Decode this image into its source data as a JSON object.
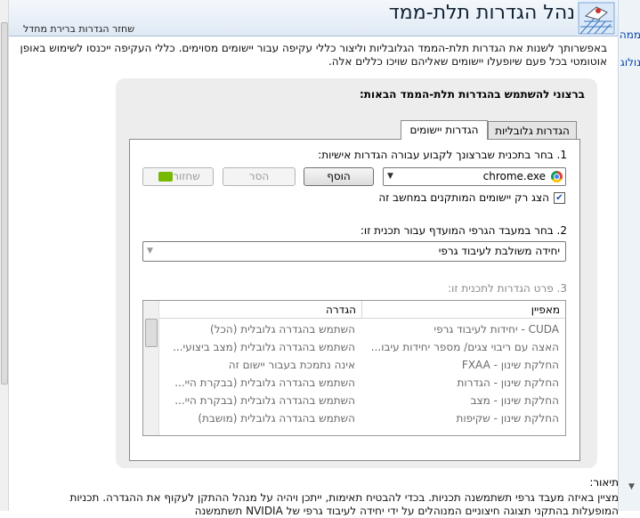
{
  "header": {
    "title": "נהל הגדרות תלת-ממד",
    "restore_link": "שחזר הגדרות ברירת מחדל"
  },
  "intro_text": "באפשרותך לשנות את הגדרות תלת-הממד הגלובליות וליצור כללי עקיפה עבור יישומים מסוימים. כללי העקיפה ייכנסו לשימוש באופן אוטומטי בכל פעם שיופעלו יישומים שאליהם שויכו כללים אלה.",
  "card": {
    "question": "ברצוני להשתמש בהגדרות תלת-הממד הבאות:",
    "tabs": [
      {
        "label": "הגדרות גלובליות",
        "active": false
      },
      {
        "label": "הגדרות יישומים",
        "active": true
      }
    ]
  },
  "step1": {
    "label": "1. בחר בתכנית שברצונך לקבוע עבורה הגדרות אישיות:",
    "program": "chrome.exe",
    "add_button": "הוסף",
    "remove_button": "הסר",
    "restore_button": "שחזור",
    "checkbox_label": "הצג רק יישומים המותקנים במחשב זה",
    "checkbox_checked": true
  },
  "step2": {
    "label": "2. בחר במעבד הגרפי המועדף עבור תכנית זו:",
    "gpu": "יחידה משולבת לעיבוד גרפי"
  },
  "step3": {
    "label": "3. פרט הגדרות לתכנית זו:",
    "columns": {
      "feature": "מאפיין",
      "setting": "הגדרה"
    },
    "rows": [
      {
        "feature": "CUDA - יחידות לעיבוד גרפי",
        "setting": "השתמש בהגדרה גלובלית (הכל)"
      },
      {
        "feature": "האצה עם ריבוי צגים/ מספר יחידות עיבו...",
        "setting": "השתמש בהגדרה גלובלית (מצב ביצועי..."
      },
      {
        "feature": "החלקת שינון - FXAA",
        "setting": "אינה נתמכת בעבור יישום זה"
      },
      {
        "feature": "החלקת שינון - הגדרות",
        "setting": "השתמש בהגדרה גלובלית (בבקרת היי..."
      },
      {
        "feature": "החלקת שינון - מצב",
        "setting": "השתמש בהגדרה גלובלית (בבקרת היי..."
      },
      {
        "feature": "החלקת שינון - שקיפות",
        "setting": "השתמש בהגדרה גלובלית (מושבת)"
      }
    ]
  },
  "description": {
    "label": "תיאור:",
    "text": "מציין באיזה מעבד גרפי תשתמשנה תכניות. בכדי להבטיח תאימות, ייתכן ויהיה על מנהל ההתקן לעקוף את ההגדרה. תכניות המופעלות בהתקני תצוגה חיצוניים המנוהלים על ידי יחידה לעיבוד גרפי של NVIDIA תשתמשנה"
  },
  "right_panel": {
    "item1": "ממה",
    "item2": "נולוג"
  }
}
